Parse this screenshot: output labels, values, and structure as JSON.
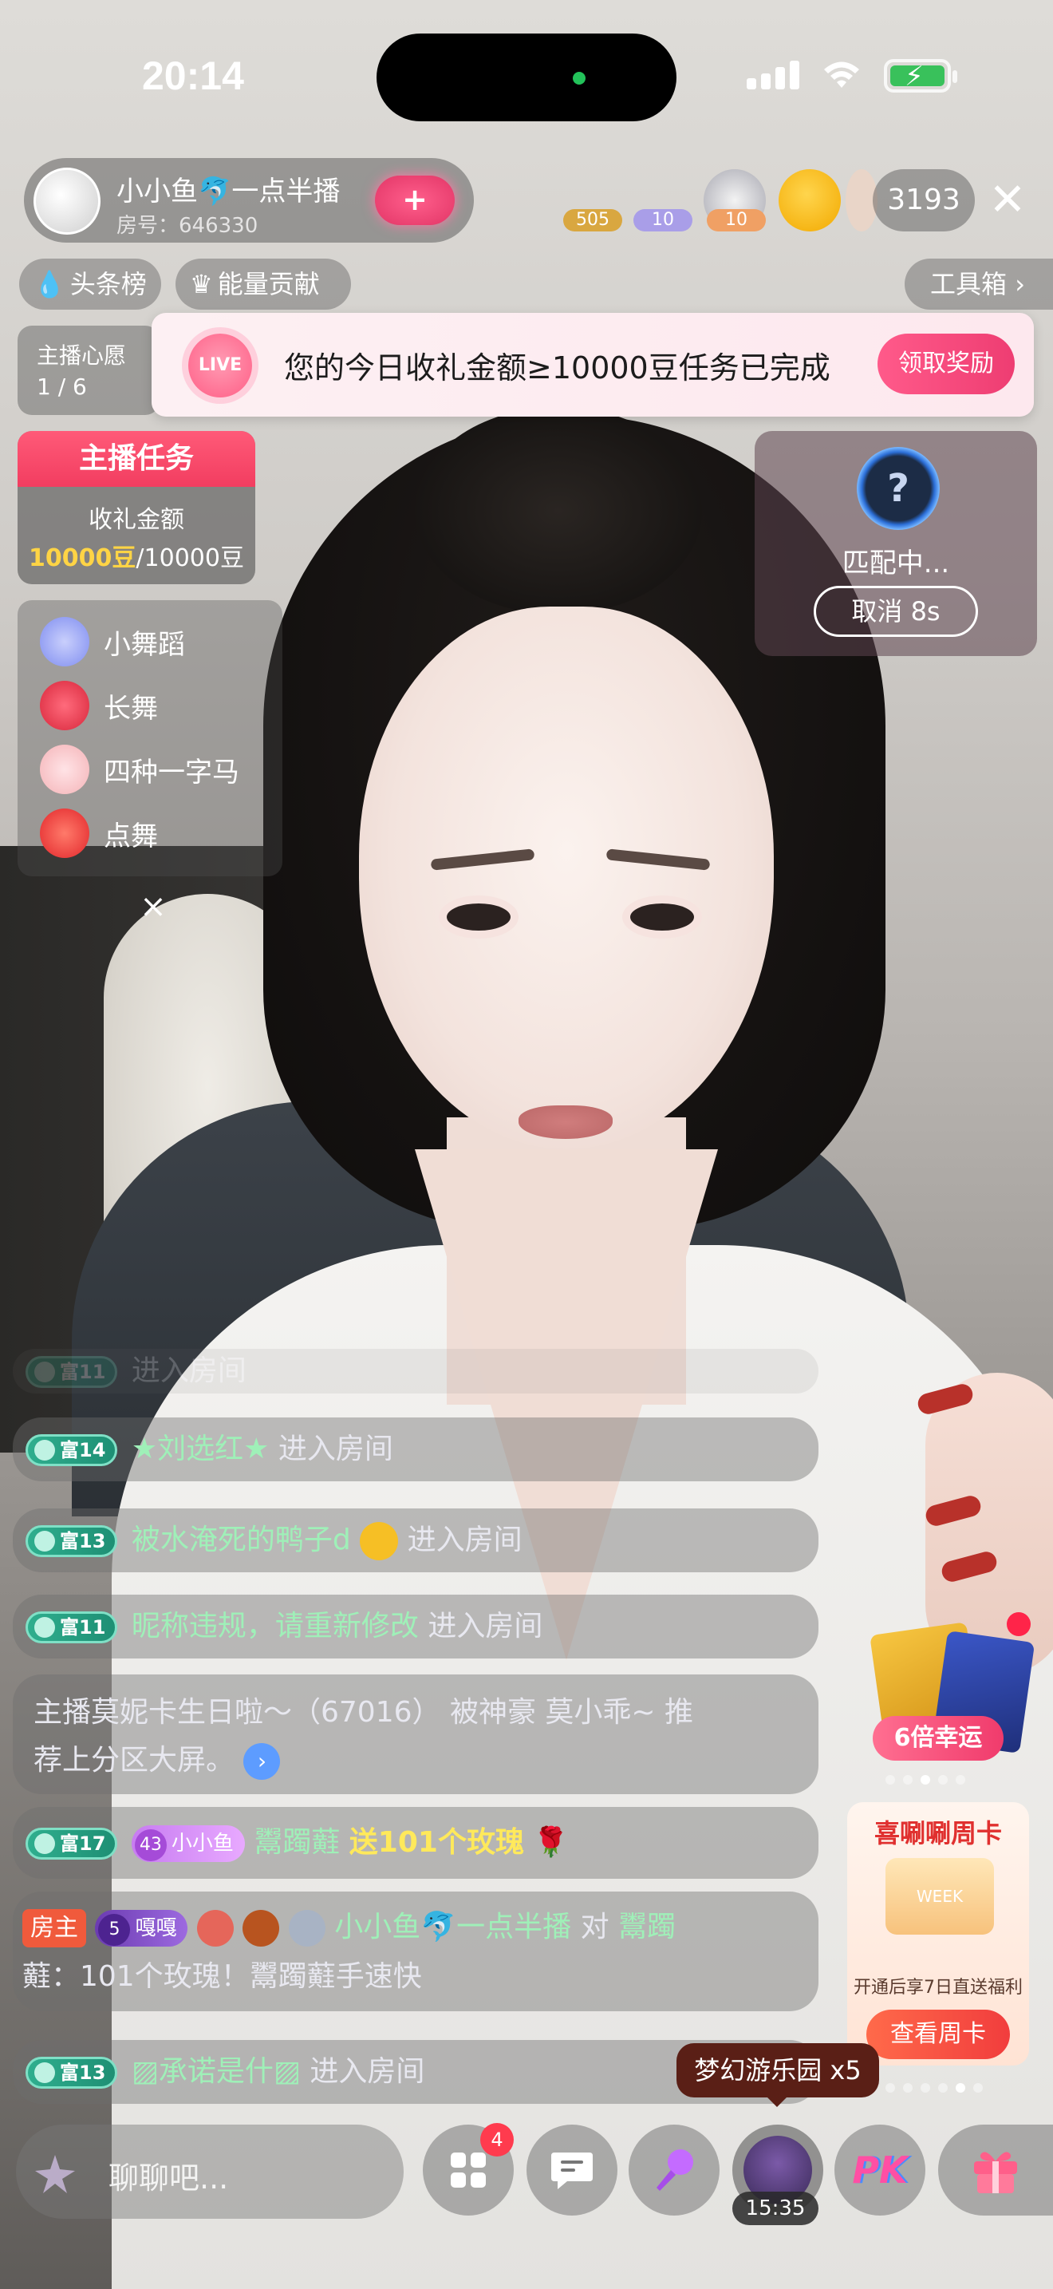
{
  "status_bar": {
    "time": "20:14"
  },
  "anchor": {
    "name": "小小鱼🐬一点半播",
    "room": "房号：646330",
    "follow_label": "+"
  },
  "viewers": {
    "badges": [
      "505",
      "10",
      "10"
    ],
    "count": "3193"
  },
  "top_tabs": {
    "headlines": "头条榜",
    "energy": "能量贡献",
    "toolbox": "工具箱"
  },
  "wish": {
    "title": "主播心愿",
    "count": "1 / 6"
  },
  "live_banner": {
    "icon_text": "LIVE",
    "message": "您的今日收礼金额≥10000豆任务已完成",
    "claim_label": "领取奖励"
  },
  "task": {
    "title": "主播任务",
    "label": "收礼金额",
    "done": "10000豆",
    "total": "/10000豆"
  },
  "matching": {
    "icon": "?",
    "status": "匹配中...",
    "cancel_label": "取消 8s"
  },
  "dance_menu": {
    "items": [
      {
        "label": "小舞蹈",
        "icon": "crystal-shoe-icon",
        "color": "#7f8df0"
      },
      {
        "label": "长舞",
        "icon": "red-lips-icon",
        "color": "#d8263b"
      },
      {
        "label": "四种一字马",
        "icon": "dancer-icon",
        "color": "#f4b3b7"
      },
      {
        "label": "点舞",
        "icon": "red-car-icon",
        "color": "#e2262b"
      }
    ],
    "close_label": "×"
  },
  "chat": {
    "faded": {
      "level": "富11",
      "text": "进入房间"
    },
    "rows": [
      {
        "level": "富14",
        "user": "★刘选红★",
        "text": "进入房间"
      },
      {
        "level": "富13",
        "user": "被水淹死的鸭子d",
        "text": "进入房间"
      },
      {
        "level": "富11",
        "user": "昵称违规，请重新修改",
        "text": "进入房间"
      }
    ],
    "system": {
      "line1": "主播莫妮卡生日啦～（67016） 被神豪 莫小乖~ 推",
      "line2": "荐上分区大屏。",
      "arrow": "›"
    },
    "gift": {
      "level": "富17",
      "fan_level": "43",
      "fan_name": "小小鱼",
      "user": "鬻躅蘳",
      "text": "送101个玫瑰"
    },
    "owner": {
      "tag": "房主",
      "badge_level": "5",
      "badge_name": "嘎嘎",
      "line1_user": "小小鱼🐬一点半播",
      "line1_text": "对",
      "line1_target": "鬻躅",
      "line2": "蘳：101个玫瑰！鬻躅蘳手速快"
    },
    "last": {
      "level": "富13",
      "user": "▨承诺是什▨",
      "text": "进入房间"
    }
  },
  "luck": {
    "label": "6倍幸运"
  },
  "week_card": {
    "title": "喜唰唰周卡",
    "image_text": "WEEK",
    "desc": "开通后享7日直送福利",
    "button": "查看周卡"
  },
  "gift_tip": "梦幻游乐园 x5",
  "bottom": {
    "input_placeholder": "聊聊吧...",
    "menu_badge": "4",
    "timer": "15:35",
    "pk_label": "PK"
  },
  "colors": {
    "accent_pink": "#f23d60",
    "gold": "#ffd445",
    "chat_name_green": "#9ff0b8",
    "rich_badge": "#2fae8e"
  }
}
